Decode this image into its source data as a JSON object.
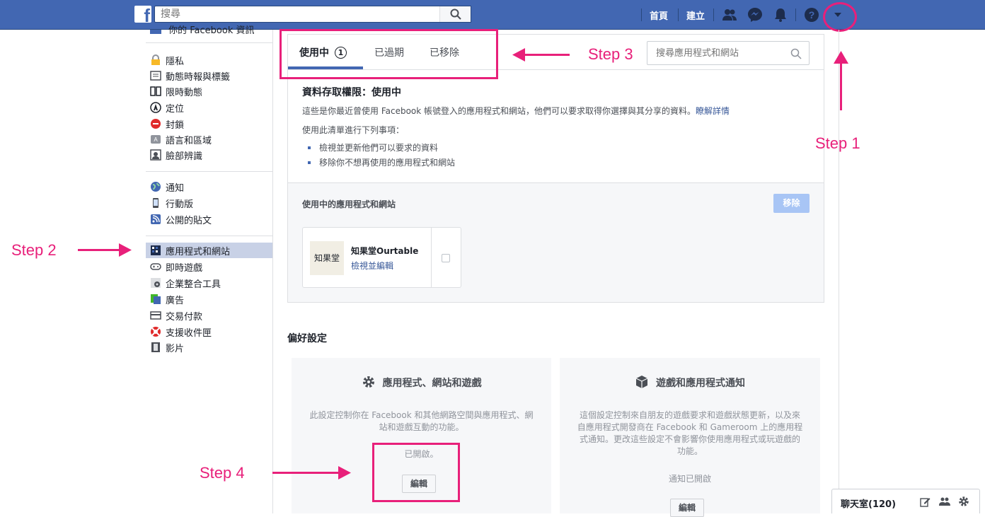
{
  "topbar": {
    "logo": "f",
    "search_placeholder": "搜尋",
    "home": "首頁",
    "create": "建立"
  },
  "sidebar": {
    "partial_top": "你的 Facebook 資訊",
    "group1": [
      "隱私",
      "動態時報與標籤",
      "限時動態",
      "定位",
      "封鎖",
      "語言和區域",
      "臉部辨識"
    ],
    "group2": [
      "通知",
      "行動版",
      "公開的貼文"
    ],
    "group3": [
      "應用程式和網站",
      "即時遊戲",
      "企業整合工具",
      "廣告",
      "交易付款",
      "支援收件匣",
      "影片"
    ]
  },
  "tabs": {
    "active": "使用中",
    "active_count": "1",
    "expired": "已過期",
    "removed": "已移除",
    "search_placeholder": "搜尋應用程式和網站"
  },
  "access": {
    "title": "資料存取權限：使用中",
    "desc": "這些是你最近曾使用 Facebook 帳號登入的應用程式和網站，他們可以要求取得你選擇與其分享的資料。",
    "learn_more": "瞭解詳情",
    "use_list": "使用此清單進行下列事項：",
    "bullets": [
      "檢視並更新他們可以要求的資料",
      "移除你不想再使用的應用程式和網站"
    ]
  },
  "active_apps": {
    "header": "使用中的應用程式和網站",
    "remove_btn": "移除",
    "app_logo_text": "知果堂",
    "app_name": "知果堂Ourtable",
    "app_link": "檢視並編輯"
  },
  "preferences": {
    "title": "偏好設定",
    "card1": {
      "title": "應用程式、網站和遊戲",
      "desc": "此設定控制你在 Facebook 和其他網路空間與應用程式、網站和遊戲互動的功能。",
      "status": "已開啟。",
      "button": "編輯"
    },
    "card2": {
      "title": "遊戲和應用程式通知",
      "desc": "這個設定控制來自朋友的遊戲要求和遊戲狀態更新，以及來自應用程式開發商在 Facebook 和 Gameroom 上的應用程式通知。更改這些設定不會影響你使用應用程式或玩遊戲的功能。",
      "status": "通知已開啟",
      "button": "編輯"
    }
  },
  "chat": {
    "label": "聊天室(120)"
  },
  "annotations": {
    "step1": "Step 1",
    "step2": "Step 2",
    "step3": "Step 3",
    "step4": "Step 4"
  },
  "colors": {
    "fb_blue": "#4267b2",
    "highlight_pink": "#e8207a",
    "link": "#385898"
  }
}
